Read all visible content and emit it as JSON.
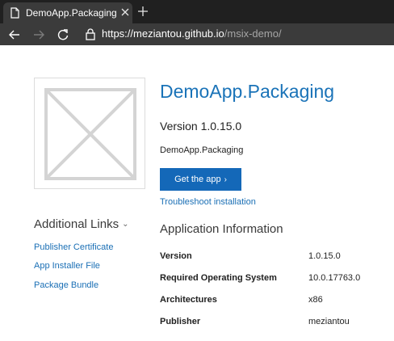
{
  "browser": {
    "tab_title": "DemoApp.Packaging",
    "url_main": "https://meziantou.github.io",
    "url_path": "/msix-demo/",
    "colors": {
      "frame": "#202020",
      "toolbar": "#3b3b3b"
    },
    "icons": [
      "page-icon",
      "close-icon",
      "new-tab-icon",
      "back-icon",
      "forward-icon",
      "refresh-icon",
      "lock-icon"
    ]
  },
  "app": {
    "title": "DemoApp.Packaging",
    "version_line": "Version 1.0.15.0",
    "description": "DemoApp.Packaging",
    "get_app_label": "Get the app",
    "get_app_chevron": "›",
    "troubleshoot_label": "Troubleshoot installation",
    "logo_icon": "image-placeholder-icon",
    "colors": {
      "title": "#1a73b8",
      "button": "#1468b8",
      "link": "#1a6fb5"
    }
  },
  "sidebar": {
    "heading": "Additional Links",
    "heading_chevron": "⌄",
    "links": [
      {
        "label": "Publisher Certificate"
      },
      {
        "label": "App Installer File"
      },
      {
        "label": "Package Bundle"
      }
    ]
  },
  "info": {
    "heading": "Application Information",
    "rows": [
      {
        "key": "Version",
        "value": "1.0.15.0"
      },
      {
        "key": "Required Operating System",
        "value": "10.0.17763.0"
      },
      {
        "key": "Architectures",
        "value": "x86"
      },
      {
        "key": "Publisher",
        "value": "meziantou"
      }
    ]
  }
}
